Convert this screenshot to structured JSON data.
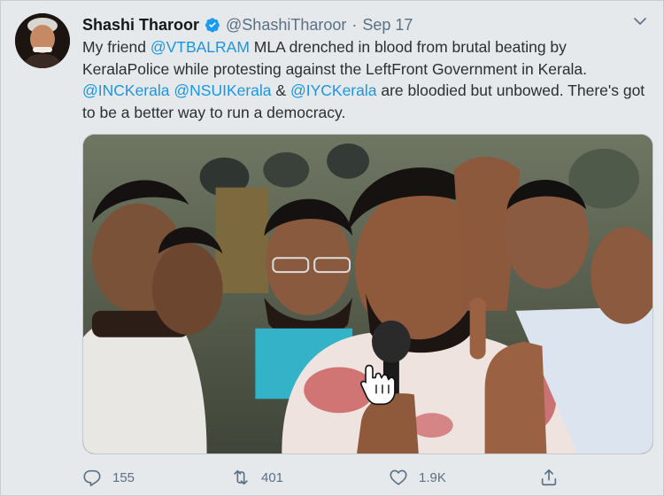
{
  "tweet": {
    "author_name": "Shashi Tharoor",
    "handle": "@ShashiTharoor",
    "separator": "·",
    "date": "Sep 17",
    "text": {
      "t1": "My friend ",
      "m1": "@VTBALRAM",
      "t2": " MLA drenched in blood from brutal beating by KeralaPolice while protesting against the LeftFront Government in Kerala. ",
      "m2": "@INCKerala",
      "t3": " ",
      "m3": "@NSUIKerala",
      "t4": " & ",
      "m4": "@IYCKerala",
      "t5": " are bloodied but unbowed. There's got to be a better way to run a democracy."
    },
    "menu_icon": "chevron-down-icon",
    "verified_icon": "verified-badge-icon"
  },
  "actions": {
    "reply_count": "155",
    "retweet_count": "401",
    "like_count": "1.9K",
    "reply_icon": "reply-icon",
    "retweet_icon": "retweet-icon",
    "like_icon": "heart-icon",
    "share_icon": "share-icon"
  },
  "colors": {
    "accent": "#1b95e0",
    "muted": "#5b7083",
    "background": "#e6e9ec"
  }
}
